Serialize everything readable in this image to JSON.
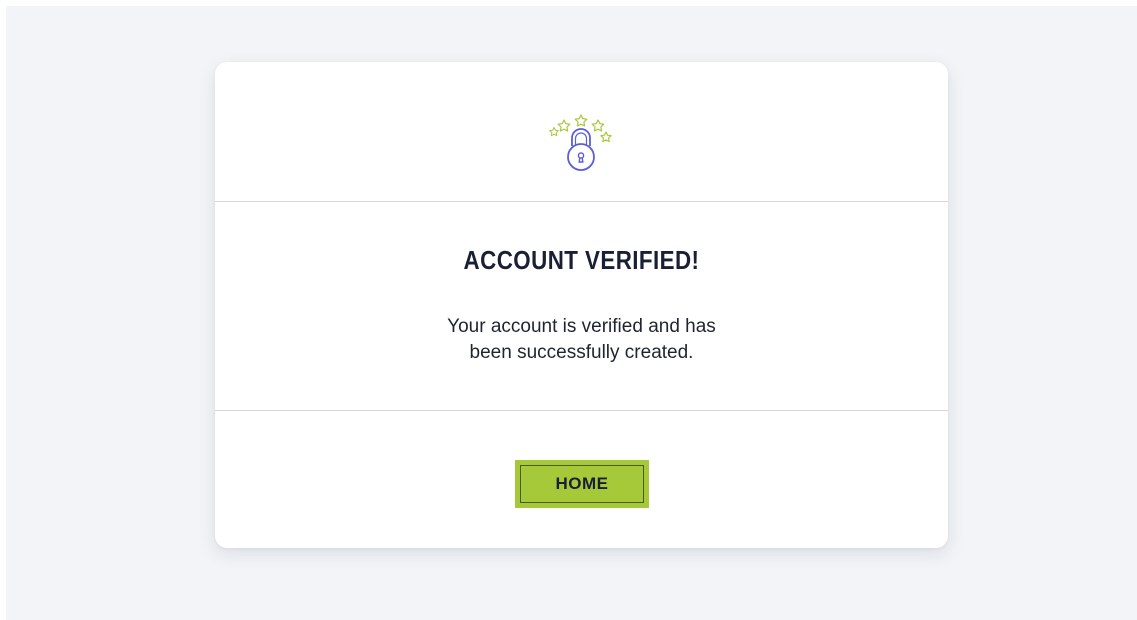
{
  "card": {
    "icon": "lock-with-stars-icon",
    "title": "ACCOUNT VERIFIED!",
    "message_line1": "Your account is verified and has",
    "message_line2": "been successfully created.",
    "home_label": "HOME"
  },
  "colors": {
    "page_background": "#f2f4f7",
    "card_background": "#ffffff",
    "accent_green": "#a6c93a",
    "lock_blue": "#5b5fd6",
    "title_text": "#1a1f36",
    "divider": "#d6d9de"
  }
}
